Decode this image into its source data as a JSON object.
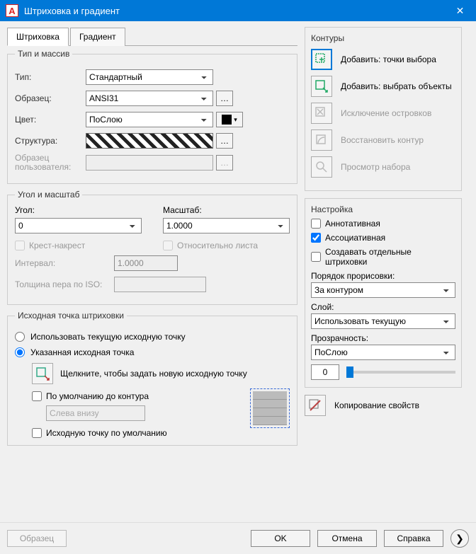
{
  "window": {
    "title": "Штриховка и градиент"
  },
  "tabs": {
    "hatch": "Штриховка",
    "gradient": "Градиент"
  },
  "type_array": {
    "legend": "Тип и массив",
    "type_label": "Тип:",
    "type_value": "Стандартный",
    "pattern_label": "Образец:",
    "pattern_value": "ANSI31",
    "color_label": "Цвет:",
    "color_value": "ПоСлою",
    "structure_label": "Структура:",
    "userpat_label": "Образец пользователя:"
  },
  "angle_scale": {
    "legend": "Угол и масштаб",
    "angle_label": "Угол:",
    "angle_value": "0",
    "scale_label": "Масштаб:",
    "scale_value": "1.0000",
    "crosshatch": "Крест-накрест",
    "paperspace": "Относительно листа",
    "spacing_label": "Интервал:",
    "spacing_value": "1.0000",
    "iso_label": "Толщина пера по ISO:"
  },
  "origin": {
    "legend": "Исходная точка штриховки",
    "use_current": "Использовать текущую исходную точку",
    "specified": "Указанная исходная точка",
    "click_hint": "Щелкните, чтобы задать новую исходную точку",
    "default_boundary": "По умолчанию до контура",
    "position": "Слева внизу",
    "store_default": "Исходную точку по умолчанию"
  },
  "boundaries": {
    "legend": "Контуры",
    "pick_points": "Добавить: точки выбора",
    "select_objects": "Добавить: выбрать объекты",
    "remove_islands": "Исключение островков",
    "recreate": "Восстановить контур",
    "view_selection": "Просмотр набора"
  },
  "options": {
    "legend": "Настройка",
    "annotative": "Аннотативная",
    "associative": "Ассоциативная",
    "separate": "Создавать отдельные штриховки",
    "draw_order_label": "Порядок прорисовки:",
    "draw_order_value": "За контуром",
    "layer_label": "Слой:",
    "layer_value": "Использовать текущую",
    "transparency_label": "Прозрачность:",
    "transparency_value": "ПоСлою",
    "transparency_num": "0"
  },
  "inherit": {
    "label": "Копирование свойств"
  },
  "footer": {
    "preview": "Образец",
    "ok": "OK",
    "cancel": "Отмена",
    "help": "Справка"
  }
}
